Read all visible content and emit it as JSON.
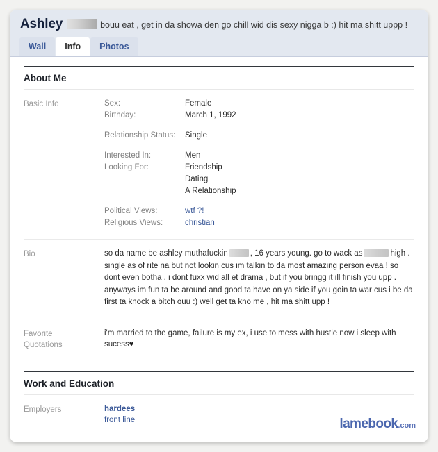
{
  "profile": {
    "name": "Ashley",
    "name_redacted": true,
    "status_text": "bouu eat , get in da showa den go chill wid dis sexy nigga b :) hit ma shitt uppp !"
  },
  "tabs": [
    {
      "label": "Wall",
      "active": false
    },
    {
      "label": "Info",
      "active": true
    },
    {
      "label": "Photos",
      "active": false
    }
  ],
  "sections": {
    "about_me": {
      "heading": "About Me",
      "basic_info": {
        "label": "Basic Info",
        "groups": [
          {
            "lines": [
              {
                "key": "Sex:",
                "value": "Female"
              },
              {
                "key": "Birthday:",
                "value": "March 1, 1992"
              }
            ]
          },
          {
            "lines": [
              {
                "key": "Relationship Status:",
                "value": "Single"
              }
            ]
          },
          {
            "lines": [
              {
                "key": "Interested In:",
                "value": "Men"
              },
              {
                "key": "Looking For:",
                "value": "Friendship"
              },
              {
                "key": "",
                "value": "Dating"
              },
              {
                "key": "",
                "value": "A Relationship"
              }
            ]
          },
          {
            "lines": [
              {
                "key": "Political Views:",
                "value": "wtf ?!",
                "link": true
              },
              {
                "key": "Religious Views:",
                "value": "christian",
                "link": true
              }
            ]
          }
        ]
      },
      "bio": {
        "label": "Bio",
        "part1": "so da name be ashley muthafuckin",
        "part2": ", 16 years young. go to wack as",
        "part3": "high .",
        "part4": "single as of rite na but not lookin cus im talkin to da most amazing person evaa ! so dont even botha . i dont fuxx wid all et drama , but if you bringg it ill finish you upp . anyways im fun ta be around and good ta have on ya side if you goin ta war cus i be da first ta knock a bitch ouu :) well get ta kno me , hit ma shitt upp !"
      },
      "favorite_quotations": {
        "label_line1": "Favorite",
        "label_line2": "Quotations",
        "text": "i'm married to the game, failure is my ex, i use to mess with hustle now i sleep with sucess",
        "heart": "♥"
      }
    },
    "work_and_education": {
      "heading": "Work and Education",
      "employers": {
        "label": "Employers",
        "company": "hardees",
        "position": "front line"
      }
    }
  },
  "watermark": {
    "brand": "lamebook",
    "tld": ".com"
  }
}
